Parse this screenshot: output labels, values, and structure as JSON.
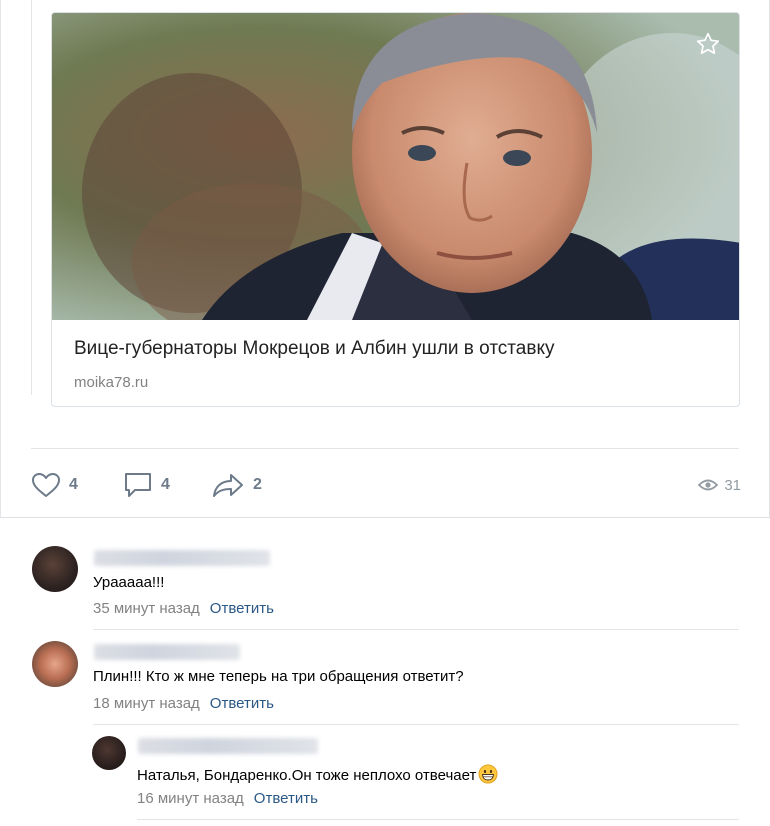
{
  "post": {
    "link_title": "Вице-губернаторы Мокрецов и Албин ушли в отставку",
    "link_domain": "moika78.ru",
    "likes": "4",
    "comments": "4",
    "shares": "2",
    "views": "31"
  },
  "comments": [
    {
      "text": "Урааааа!!!",
      "time": "35 минут назад",
      "reply_label": "Ответить"
    },
    {
      "text": "Плин!!! Кто ж мне теперь на три обращения ответит?",
      "time": "18 минут назад",
      "reply_label": "Ответить"
    },
    {
      "text": "Наталья, Бондаренко.Он тоже неплохо отвечает",
      "time": "16 минут назад",
      "reply_label": "Ответить"
    }
  ],
  "icons": {
    "like": "heart-icon",
    "comment": "speech-bubble-icon",
    "share": "share-arrow-icon",
    "views": "eye-icon",
    "bookmark": "star-icon",
    "emoji": "grinning-face-emoji"
  },
  "colors": {
    "link": "#2a5885",
    "muted": "#828282",
    "action": "#6c7a89"
  }
}
